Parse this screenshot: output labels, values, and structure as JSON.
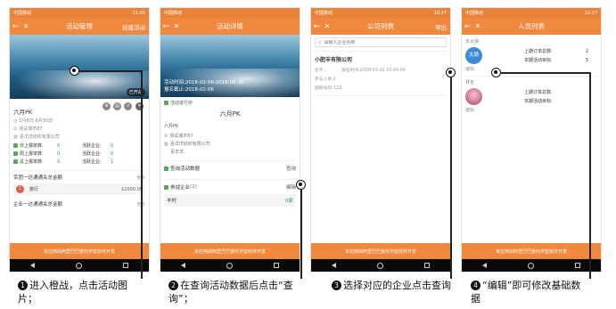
{
  "status": {
    "carrier": "中国移动",
    "time1": "11:45",
    "time2": "",
    "time3": "10:27",
    "time4": "10:27"
  },
  "footer_text": "本应用由阿里巴巴委托字篮软件开发",
  "screen1": {
    "title": "活动管理",
    "right": "创建活动",
    "badge": "已开战",
    "pk_name": "六月PK",
    "date": "2月8日-6月30日",
    "city": "测试城市87",
    "company": "喜洋洋纺织有限公司",
    "stats": [
      {
        "label": "日上报单数:",
        "value": "0",
        "label2": "活跃企业:",
        "value2": "0"
      },
      {
        "label": "周上报单数:",
        "value": "0",
        "label2": "活跃企业:",
        "value2": "0"
      },
      {
        "label": "总上报单数:",
        "value": "0",
        "label2": "活跃企业:",
        "value2": "1"
      }
    ],
    "section1": "军团一达通通关总金额",
    "more": "更多",
    "rank_num": "1",
    "rank_name": "旅行",
    "rank_amount": "$2000.00",
    "section2": "企业一达通通关总金额"
  },
  "screen2": {
    "title": "活动详情",
    "time": "活动时间:2018-02-08-2018-06-30",
    "deadline": "报名截止:2018-02-06",
    "status": "活动进行中",
    "pk_name": "六月PK",
    "pk_small": "六月PK",
    "city": "测试城市87",
    "company": "喜洋洋纺织有限公司",
    "person": "喜羊羊",
    "query_label": "查询活动数据",
    "query_btn": "查询",
    "join_label": "参战企业",
    "join_count": "(2)",
    "edit_btn": "编辑",
    "item": "羊村",
    "item_right": "0家"
  },
  "screen3": {
    "title": "公司列表",
    "right": "导出",
    "search_placeholder": "请输入企业名称",
    "company": "小肥羊有限公司",
    "name_label": "名字:",
    "signup_label": "报名时间:2018-03-02 10:04:04",
    "count_label": "参与人数:2",
    "site_label": "国际站ID:123"
  },
  "screen4": {
    "title": "人员列表",
    "p1": {
      "name": "东太狼",
      "avatar": "太狼",
      "orders": "上期订单总数:",
      "orders_v": "2",
      "target": "本期活动目标:",
      "target_v": "5",
      "edit": "编辑"
    },
    "p2": {
      "name": "林宣",
      "orders": "上期订单总数:",
      "orders_v": "",
      "target": "本期活动目标:",
      "target_v": "",
      "edit": "编辑"
    }
  },
  "captions": {
    "c1_num": "1",
    "c1": "进入橙战，点击活动图片；",
    "c2_num": "2",
    "c2": "在查询活动数据后点击“查询”；",
    "c3_num": "3",
    "c3": "选择对应的企业点击查询",
    "c4_num": "4",
    "c4": "“编辑”即可修改基础数据"
  },
  "colors": {
    "accent": "#f0883e",
    "green": "#2f9d4e"
  }
}
